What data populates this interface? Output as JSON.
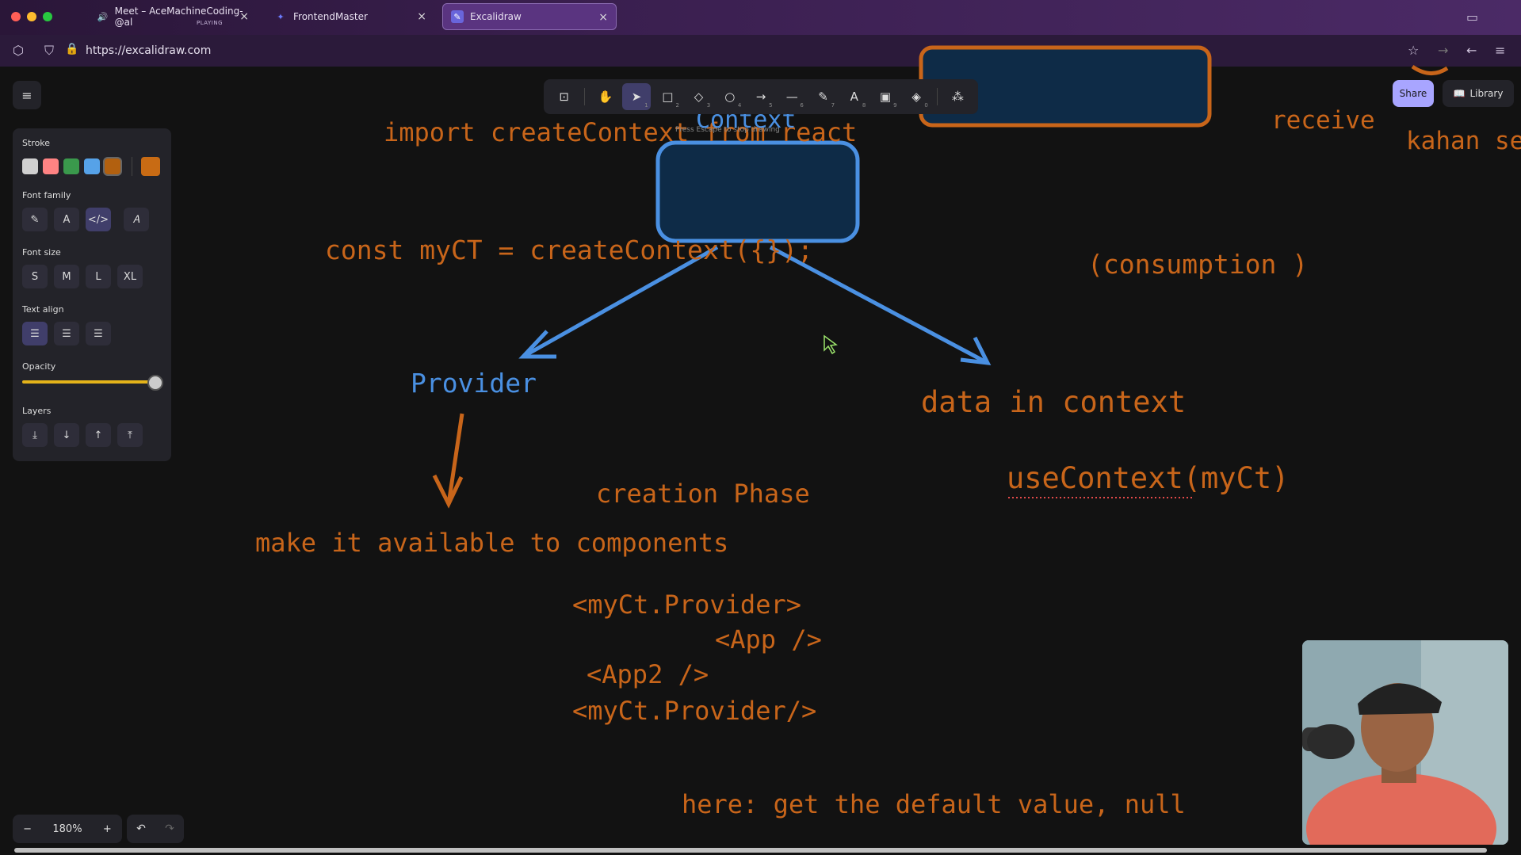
{
  "browser": {
    "tabs": [
      {
        "title": "Meet – AceMachineCoding-@al",
        "status": "PLAYING",
        "active": false
      },
      {
        "title": "FrontendMaster",
        "active": false
      },
      {
        "title": "Excalidraw",
        "active": true
      }
    ],
    "url": "https://excalidraw.com"
  },
  "toolbar": {
    "tools": [
      {
        "name": "lock",
        "num": ""
      },
      {
        "name": "hand",
        "num": ""
      },
      {
        "name": "selection",
        "num": "1"
      },
      {
        "name": "rectangle",
        "num": "2"
      },
      {
        "name": "diamond",
        "num": "3"
      },
      {
        "name": "ellipse",
        "num": "4"
      },
      {
        "name": "arrow",
        "num": "5"
      },
      {
        "name": "line",
        "num": "6"
      },
      {
        "name": "draw",
        "num": "7"
      },
      {
        "name": "text",
        "num": "8"
      },
      {
        "name": "image",
        "num": "9"
      },
      {
        "name": "eraser",
        "num": "0"
      }
    ],
    "hint": "Press Escape to stop drawing"
  },
  "panel": {
    "stroke_label": "Stroke",
    "stroke_colors": [
      "#d0d0d0",
      "#ff8383",
      "#3a994c",
      "#56a2e8",
      "#b2600f"
    ],
    "stroke_selected": "#c86b14",
    "font_family_label": "Font family",
    "font_size_label": "Font size",
    "font_sizes": [
      "S",
      "M",
      "L",
      "XL"
    ],
    "text_align_label": "Text align",
    "opacity_label": "Opacity",
    "opacity_value": 100,
    "layers_label": "Layers"
  },
  "top_right": {
    "share": "Share",
    "library": "Library"
  },
  "zoom": {
    "minus": "−",
    "level": "180%",
    "plus": "+"
  },
  "canvas": {
    "import_line": "import createContext from react",
    "context_label": "Context",
    "const_line": "const myCT = createContext({});",
    "receive": "receive",
    "kahan": "kahan se",
    "consumption": "(consumption )",
    "provider": "Provider",
    "data_in_context": "data in context",
    "use_context": "useContext(myCt)",
    "creation_phase": "creation Phase",
    "make_available": "make it available to components",
    "code_lines": [
      "<myCt.Provider>",
      "<App />",
      "<App2 />",
      "<myCt.Provider/>"
    ],
    "default_value": "here: get the default value, null"
  },
  "colors": {
    "accent": "#c8651a",
    "blue": "#4a90e2",
    "ui_bg": "#232329",
    "share": "#a8a5ff"
  }
}
